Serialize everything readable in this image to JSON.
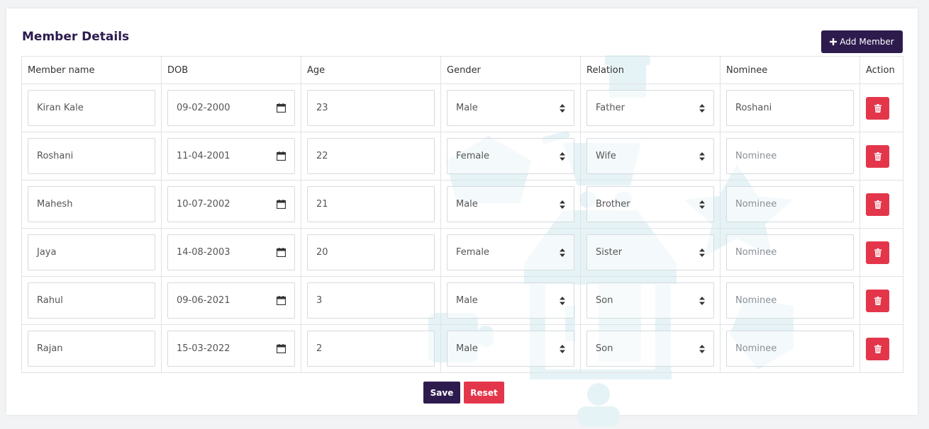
{
  "page": {
    "title": "Member Details"
  },
  "actions": {
    "add_label": "Add Member",
    "save_label": "Save",
    "reset_label": "Reset"
  },
  "table": {
    "headers": [
      "Member name",
      "DOB",
      "Age",
      "Gender",
      "Relation",
      "Nominee",
      "Action"
    ],
    "nominee_placeholder": "Nominee",
    "rows": [
      {
        "name": "Kiran Kale",
        "dob": "09-02-2000",
        "age": "23",
        "gender": "Male",
        "relation": "Father",
        "nominee": "Roshani"
      },
      {
        "name": "Roshani",
        "dob": "11-04-2001",
        "age": "22",
        "gender": "Female",
        "relation": "Wife",
        "nominee": ""
      },
      {
        "name": "Mahesh",
        "dob": "10-07-2002",
        "age": "21",
        "gender": "Male",
        "relation": "Brother",
        "nominee": ""
      },
      {
        "name": "Jaya",
        "dob": "14-08-2003",
        "age": "20",
        "gender": "Female",
        "relation": "Sister",
        "nominee": ""
      },
      {
        "name": "Rahul",
        "dob": "09-06-2021",
        "age": "3",
        "gender": "Male",
        "relation": "Son",
        "nominee": ""
      },
      {
        "name": "Rajan",
        "dob": "15-03-2022",
        "age": "2",
        "gender": "Male",
        "relation": "Son",
        "nominee": ""
      }
    ]
  },
  "icons": {
    "add": "plus-icon",
    "dob": "calendar-icon",
    "select": "select-arrows-icon",
    "delete": "trash-icon",
    "background": "shop-watermark-icon"
  },
  "colors": {
    "primary": "#2d1b4e",
    "danger": "#e4364a",
    "border": "#dfe2e6",
    "watermark": "#d5eef2"
  }
}
